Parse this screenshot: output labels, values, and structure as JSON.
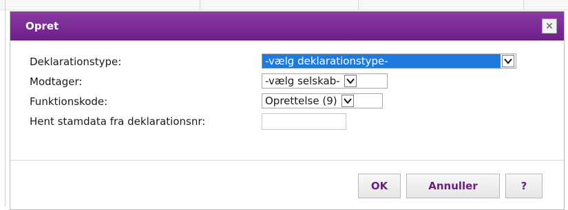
{
  "dialog": {
    "title": "Opret",
    "close_label": "×"
  },
  "form": {
    "rows": [
      {
        "label": "Deklarationstype:",
        "value": "-vælg deklarationstype-",
        "selected": true
      },
      {
        "label": "Modtager:",
        "value": "-vælg selskab-"
      },
      {
        "label": "Funktionskode:",
        "value": "Oprettelse (9)"
      },
      {
        "label": "Hent stamdata fra deklarationsnr:",
        "value": ""
      }
    ]
  },
  "buttons": {
    "ok": "OK",
    "cancel": "Annuller",
    "help": "?"
  },
  "colors": {
    "titlebar": "#7a2a96",
    "button_text": "#6d1f86",
    "select_highlight": "#1f7ae0"
  }
}
